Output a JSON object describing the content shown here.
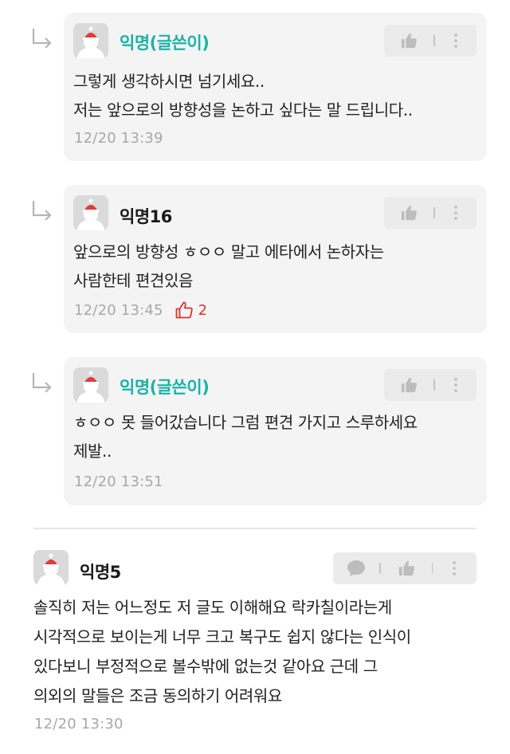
{
  "comments": [
    {
      "nickname": "익명(글쓴이)",
      "lines": [
        "그렇게 생각하시면 넘기세요..",
        "저는 앞으로의 방향성을 논하고 싶다는 말 드립니다.."
      ],
      "time": "12/20 13:39"
    },
    {
      "nickname": "익명16",
      "lines": [
        "앞으로의 방향성 ㅎㅇㅇ 말고 에타에서 논하자는",
        "사람한테 편견있음"
      ],
      "time": "12/20 13:45",
      "likes": "2"
    },
    {
      "nickname": "익명(글쓴이)",
      "lines": [
        "ㅎㅇㅇ 못 들어갔습니다 그럼 편견 가지고 스루하세요",
        "제발.."
      ],
      "time": "12/20 13:51"
    },
    {
      "nickname": "익명5",
      "lines": [
        "솔직히 저는 어느정도 저 글도 이해해요 락카칠이라는게",
        "시각적으로 보이는게 너무 크고 복구도 쉽지 않다는 인식이",
        "있다보니 부정적으로 볼수밖에 없는것 같아요 근데 그",
        "의외의 말들은 조금 동의하기 어려워요"
      ],
      "time": "12/20 13:30"
    }
  ],
  "icons": {
    "reply_arrow": "reply-arrow-icon",
    "thumb": "thumbs-up-icon",
    "more": "more-vertical-icon",
    "comment": "speech-bubble-icon",
    "like": "thumbs-up-outline-icon"
  },
  "colors": {
    "writer_nickname": "#19b3a8",
    "like_count": "#e0312e",
    "card_bg": "#f4f4f4",
    "timestamp": "#a8a8a8"
  }
}
